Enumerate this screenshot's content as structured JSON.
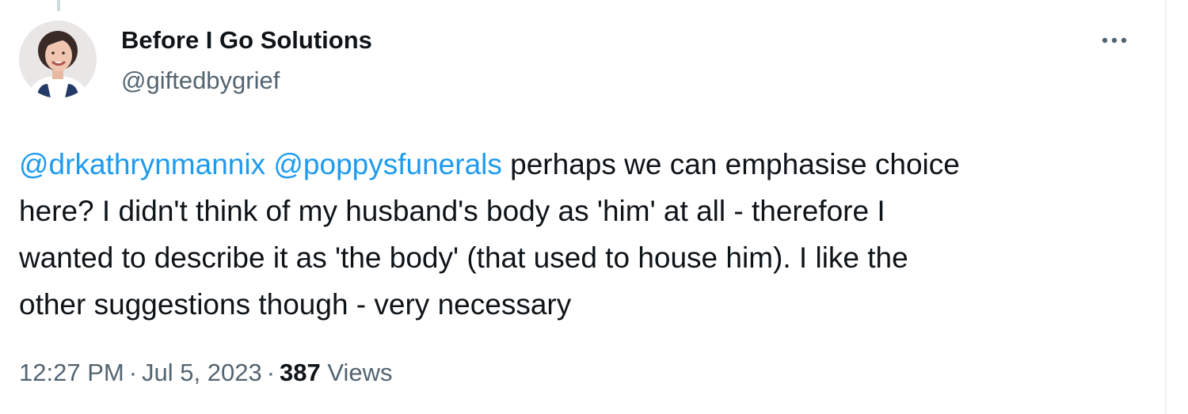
{
  "author": {
    "display_name": "Before I Go Solutions",
    "handle": "@giftedbygrief"
  },
  "tweet": {
    "line1": {
      "mention1": "@drkathrynmannix",
      "mention2": "@poppysfunerals",
      "text": " perhaps we can emphasise choice"
    },
    "line2": "here?  I didn't think of my husband's body as 'him' at all - therefore I",
    "line3": "wanted to describe it as 'the body' (that used to house him).  I like the",
    "line4": "other suggestions though - very necessary"
  },
  "meta": {
    "time": "12:27 PM",
    "separator": "·",
    "date": "Jul 5, 2023",
    "views_count": "387",
    "views_label": "Views"
  },
  "icons": {
    "more": "more-horizontal-icon",
    "avatar": "profile-photo"
  },
  "colors": {
    "link": "#1d9bf0",
    "secondary_text": "#536471",
    "primary_text": "#0f1419"
  }
}
